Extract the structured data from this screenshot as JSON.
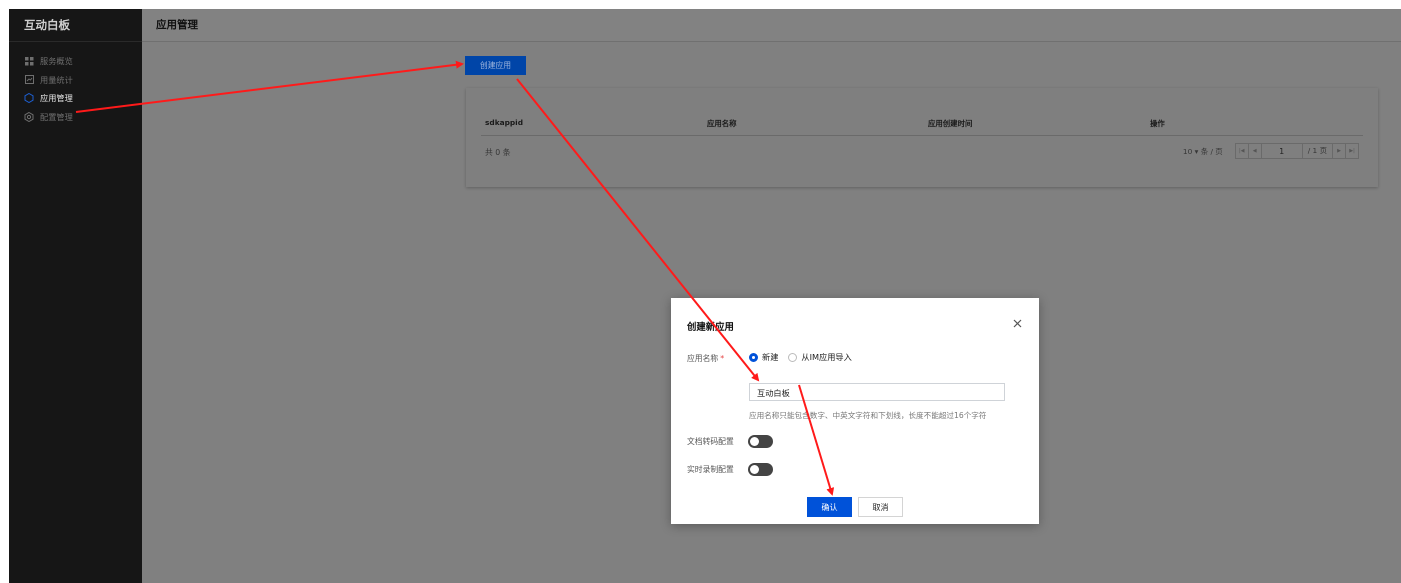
{
  "sidebar": {
    "brand": "互动白板",
    "items": [
      {
        "label": "服务概览",
        "icon": "grid-icon"
      },
      {
        "label": "用量统计",
        "icon": "chart-icon"
      },
      {
        "label": "应用管理",
        "icon": "hexagon-icon",
        "active": true
      },
      {
        "label": "配置管理",
        "icon": "settings-icon"
      }
    ]
  },
  "header": {
    "title": "应用管理"
  },
  "toolbar": {
    "create_label": "创建应用"
  },
  "table": {
    "columns": [
      "sdkappid",
      "应用名称",
      "应用创建时间",
      "操作"
    ],
    "total": "共 0 条",
    "page_size": "10 ▾ 条 / 页",
    "current_page": "1",
    "total_pages": "/ 1 页"
  },
  "modal": {
    "title": "创建新应用",
    "name_label": "应用名称",
    "required_mark": "*",
    "radio_options": [
      "新建",
      "从IM应用导入"
    ],
    "selected_option": "新建",
    "name_value": "互动白板",
    "hint": "应用名称只能包含数字、中英文字符和下划线，长度不能超过16个字符",
    "doc_transcode_label": "文档转码配置",
    "doc_transcode_on": false,
    "recording_label": "实时录制配置",
    "recording_on": false,
    "confirm_label": "确认",
    "cancel_label": "取消"
  },
  "colors": {
    "primary": "#0052d9",
    "sidebar_bg": "#161616",
    "overlay_bg": "#808080",
    "arrow": "#ff0000"
  }
}
